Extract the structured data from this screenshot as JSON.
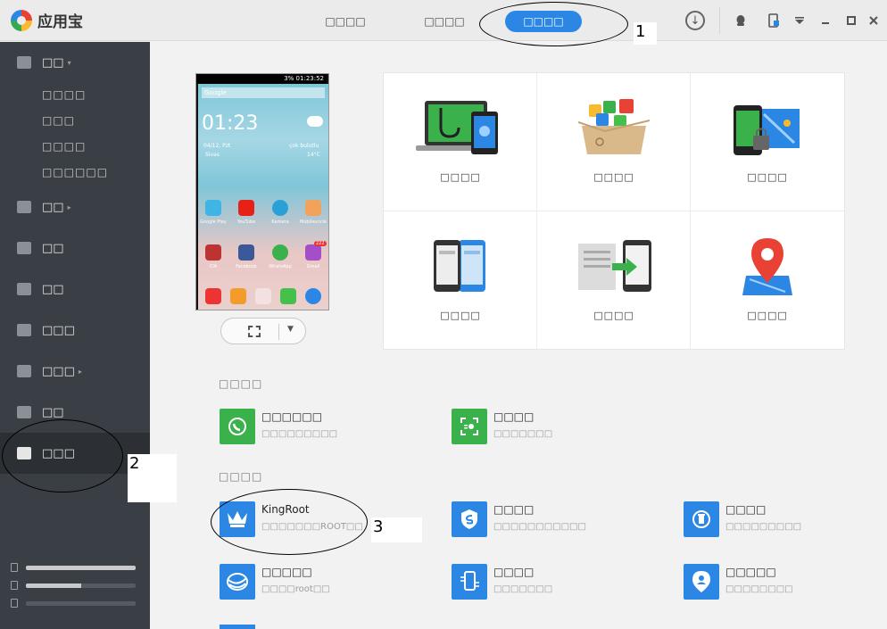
{
  "app": {
    "name": "应用宝",
    "accent_color": "#2b87e3"
  },
  "top_tabs": [
    {
      "label": "□□□□",
      "active": false
    },
    {
      "label": "□□□□",
      "active": false
    },
    {
      "label": "□□□□",
      "active": true
    }
  ],
  "top_icons": [
    "download-icon",
    "qq-icon",
    "phone-sync-icon",
    "dropdown-menu-icon",
    "minimize-icon",
    "maximize-icon",
    "close-icon"
  ],
  "annotations": {
    "one": "1",
    "two": "2",
    "three": "3"
  },
  "sidebar": {
    "items": [
      {
        "label": "□□",
        "icon": "phone-icon",
        "arrow": "▾"
      },
      {
        "label": "□□",
        "icon": "image-icon",
        "arrow": "▸"
      },
      {
        "label": "□□",
        "icon": "video-icon",
        "arrow": ""
      },
      {
        "label": "□□",
        "icon": "music-icon",
        "arrow": ""
      },
      {
        "label": "□□□",
        "icon": "document-icon",
        "arrow": ""
      },
      {
        "label": "□□□",
        "icon": "contacts-icon",
        "arrow": "▸"
      },
      {
        "label": "□□",
        "icon": "message-icon",
        "arrow": ""
      },
      {
        "label": "□□□",
        "icon": "toolbox-icon",
        "arrow": "",
        "active": true
      }
    ],
    "sub_items": [
      "□□□□",
      "□□□",
      "□□□□",
      "□□□□□□"
    ],
    "storage": [
      {
        "icon": "phone-storage-icon",
        "fill": 1.0
      },
      {
        "icon": "sd-storage-icon",
        "fill": 0.5
      },
      {
        "icon": "file-storage-icon",
        "fill": 0.0
      }
    ]
  },
  "phone": {
    "status_time": "01:23:52",
    "battery": "3%",
    "search_label": "Google",
    "clock": "01:23",
    "date": "04/12, Pzt",
    "weather": "çok bulutlu",
    "location": "Sivas",
    "temperature": "14°C",
    "apps_row1": [
      "Google Play",
      "YouTube",
      "Kamera",
      "Mobileuncle"
    ],
    "apps_row2": [
      "CIA",
      "Facebook",
      "WhatsApp",
      "Gmail"
    ],
    "gmail_badge": "222"
  },
  "features": [
    {
      "label": "□□□□",
      "icon": "phone-diagnosis-icon"
    },
    {
      "label": "□□□□",
      "icon": "app-box-icon"
    },
    {
      "label": "□□□□",
      "icon": "phone-lock-map-icon"
    },
    {
      "label": "□□□□",
      "icon": "dual-phone-icon"
    },
    {
      "label": "□□□□",
      "icon": "file-transfer-icon"
    },
    {
      "label": "□□□□",
      "icon": "location-pin-icon"
    }
  ],
  "section1": {
    "title": "□□□□",
    "tools": [
      {
        "name": "□□□□□□",
        "desc": "□□□□□□□□□",
        "icon": "whatsapp-icon",
        "color": "#3ab14a"
      },
      {
        "name": "□□□□",
        "desc": "□□□□□□□",
        "icon": "scan-icon",
        "color": "#3ab14a"
      }
    ]
  },
  "section2": {
    "title": "□□□□",
    "tools": [
      {
        "name": "KingRoot",
        "desc": "□□□□□□□ROOT□□",
        "icon": "crown-icon",
        "color": "#2b87e3"
      },
      {
        "name": "□□□□",
        "desc": "□□□□□□□□□□□",
        "icon": "shield-icon",
        "color": "#2b87e3"
      },
      {
        "name": "□□□□",
        "desc": "□□□□□□□□□",
        "icon": "refresh-trash-icon",
        "color": "#2b87e3"
      },
      {
        "name": "□□□□□",
        "desc": "□□□□root□□",
        "icon": "globe-icon",
        "color": "#2b87e3"
      },
      {
        "name": "□□□□",
        "desc": "□□□□□□□",
        "icon": "phone-transfer-icon",
        "color": "#2b87e3"
      },
      {
        "name": "□□□□□",
        "desc": "□□□□□□□□",
        "icon": "user-pin-icon",
        "color": "#2b87e3"
      }
    ]
  }
}
